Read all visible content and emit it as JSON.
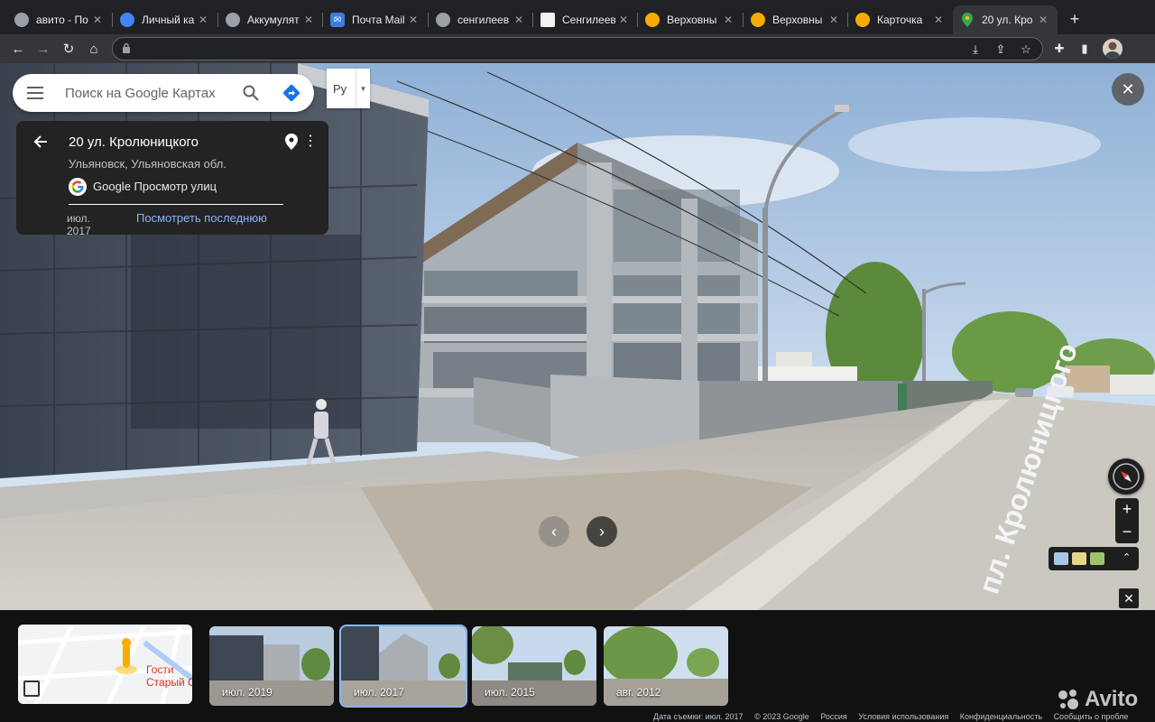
{
  "browser": {
    "tabs": [
      {
        "title": "авито - По",
        "favicon_color": "#9aa0a6",
        "active": false
      },
      {
        "title": "Личный ка",
        "favicon_color": "#4285f4",
        "active": false
      },
      {
        "title": "Аккумулят",
        "favicon_color": "#9aa0a6",
        "active": false
      },
      {
        "title": "Почта Mail",
        "favicon_color": "#3d7ce4",
        "active": false
      },
      {
        "title": "сенгилеев",
        "favicon_color": "#9aa0a6",
        "active": false
      },
      {
        "title": "Сенгилеев",
        "favicon_color": "#f1f3f4",
        "active": false
      },
      {
        "title": "Верховны",
        "favicon_color": "#f9ab00",
        "active": false
      },
      {
        "title": "Верховны",
        "favicon_color": "#f9ab00",
        "active": false
      },
      {
        "title": "Карточка",
        "favicon_color": "#f9ab00",
        "active": false
      },
      {
        "title": "20 ул. Кро",
        "favicon_color": "#34a853",
        "active": true
      }
    ],
    "new_tab_label": "+",
    "close_tab_glyph": "✕",
    "nav": {
      "back": "←",
      "forward": "→",
      "reload": "↻",
      "home": "⌂"
    },
    "address": ""
  },
  "maps": {
    "search_placeholder": "Поиск на Google Картах",
    "language": "Ру",
    "card": {
      "address": "20 ул. Кролюницкого",
      "region": "Ульяновск, Ульяновская обл.",
      "source": "Google Просмотр улиц",
      "date": "июл. 2017",
      "latest_link": "Посмотреть последнюю"
    },
    "close_glyph": "✕",
    "zoom_in": "+",
    "zoom_out": "−",
    "layers_expand": "⌃"
  },
  "filmstrip": {
    "minimap_place": "Гостиница Старый Симб",
    "minimap_place_line1": "Гости",
    "minimap_place_line2": "Старый Симб",
    "thumbnails": [
      {
        "label": "июл. 2019",
        "active": false
      },
      {
        "label": "июл. 2017",
        "active": true
      },
      {
        "label": "июл. 2015",
        "active": false
      },
      {
        "label": "авг. 2012",
        "active": false
      }
    ]
  },
  "footer": {
    "capture_date": "Дата съемки: июл. 2017",
    "copyright": "© 2023 Google",
    "country": "Россия",
    "terms": "Условия использования",
    "privacy": "Конфиденциальность",
    "report": "Сообщить о пробле"
  },
  "watermark": "Avito",
  "colors": {
    "chrome_bg": "#202124",
    "toolbar_bg": "#35363a",
    "link_blue": "#8ab4f8",
    "google_blue": "#1a73e8"
  }
}
